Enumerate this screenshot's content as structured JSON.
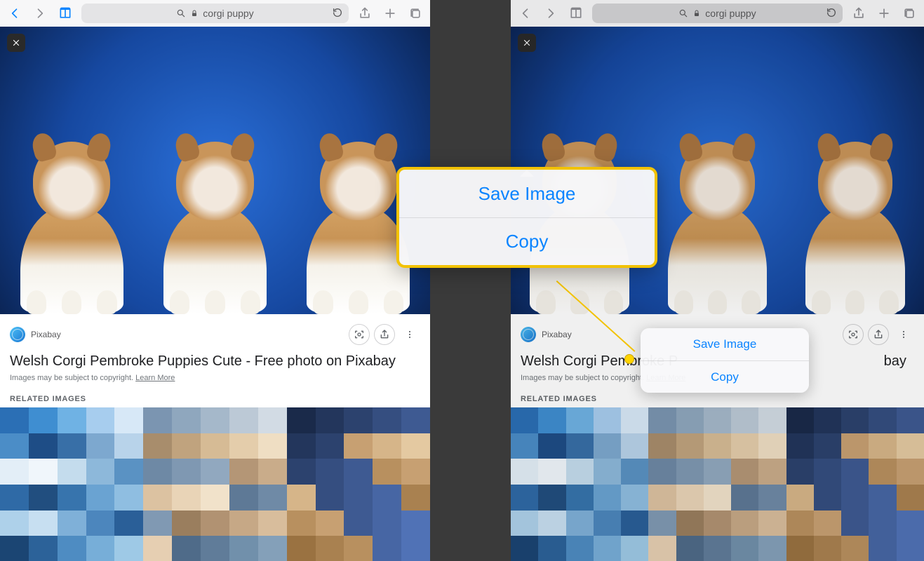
{
  "addressbar": {
    "query": "corgi puppy"
  },
  "page": {
    "source": "Pixabay",
    "title": "Welsh Corgi Pembroke Puppies Cute - Free photo on Pixabay",
    "title_truncated_right": "Welsh Corgi Pembroke P",
    "title_suffix_right": "bay",
    "copyright_prefix": "Images may be subject to copyright. ",
    "copyright_link": "Learn More",
    "related_heading": "RELATED IMAGES"
  },
  "popover": {
    "save_label": "Save Image",
    "copy_label": "Copy"
  },
  "thumb_palettes": [
    [
      "#2b6fb5",
      "#3f8ed1",
      "#6fb2e4",
      "#a7cdee",
      "#d7e8f7",
      "#4b8dc7",
      "#1e4d86",
      "#386fa7",
      "#7da8cf",
      "#b8d3ea",
      "#e3eef7",
      "#f0f6fb",
      "#c4dced",
      "#8db8da",
      "#5a92c3",
      "#2f6aa6",
      "#214e7f",
      "#3774ad",
      "#6aa3d2",
      "#8fbee1",
      "#aed1ea",
      "#c7dff1",
      "#7fb0d8",
      "#4c86bd",
      "#2a5f98",
      "#1b4573",
      "#2c6299",
      "#4e8cc2",
      "#77aed8",
      "#9ec9e6"
    ],
    [
      "#7b95b1",
      "#8fa7be",
      "#a5b8ca",
      "#bcc9d6",
      "#d2dbe4",
      "#a88d6c",
      "#c0a37e",
      "#d6bb95",
      "#e4cdab",
      "#efdec3",
      "#6e89a5",
      "#7f98b2",
      "#91a8bf",
      "#b49676",
      "#c9ac8a",
      "#dcc2a1",
      "#e9d4b7",
      "#f1e2ca",
      "#5e7996",
      "#6f8aa6",
      "#8099b3",
      "#9a7e5e",
      "#b19272",
      "#c6a886",
      "#d8bd9c",
      "#e6cfb2",
      "#4f6b89",
      "#607c99",
      "#7190ab",
      "#84a0b9"
    ],
    [
      "#1a2a4a",
      "#23365c",
      "#2c426e",
      "#354e80",
      "#3e5a92",
      "#23365c",
      "#2c426e",
      "#c7a072",
      "#d6b589",
      "#e4c9a1",
      "#2c426e",
      "#354e80",
      "#3e5a92",
      "#b8905f",
      "#c7a072",
      "#d6b589",
      "#354e80",
      "#3e5a92",
      "#4766a4",
      "#a98150",
      "#b8905f",
      "#c7a072",
      "#3e5a92",
      "#4766a4",
      "#5072b6",
      "#9a7241",
      "#a98150",
      "#b8905f",
      "#4766a4",
      "#5072b6"
    ]
  ]
}
